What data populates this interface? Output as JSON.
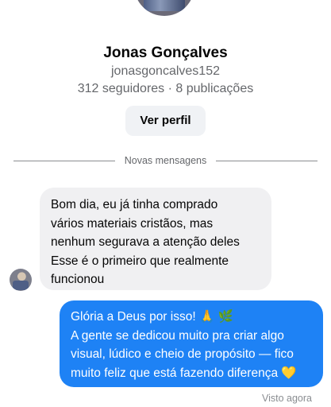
{
  "profile": {
    "name": "Jonas Gonçalves",
    "username": "jonasgoncalves152",
    "stats": "312 seguidores · 8 publicações",
    "view_profile_label": "Ver perfil"
  },
  "divider": {
    "label": "Novas mensagens"
  },
  "messages": [
    {
      "direction": "incoming",
      "lines": [
        "Bom dia, eu já tinha comprado",
        "vários materiais cristãos, mas",
        "nenhum segurava a atenção deles",
        "Esse é o primeiro que realmente",
        "funcionou"
      ]
    },
    {
      "direction": "outgoing",
      "lines": [
        "Glória a Deus por isso! 🙏 🌿",
        "A gente se dedicou muito pra criar algo",
        "visual, lúdico e cheio de propósito — fico",
        "muito feliz que está fazendo diferença 💛"
      ]
    }
  ],
  "status": {
    "seen": "Visto agora"
  },
  "colors": {
    "outgoing_bubble": "#1e82f5",
    "incoming_bubble": "#f0f0f2",
    "secondary_text": "#65676b"
  }
}
